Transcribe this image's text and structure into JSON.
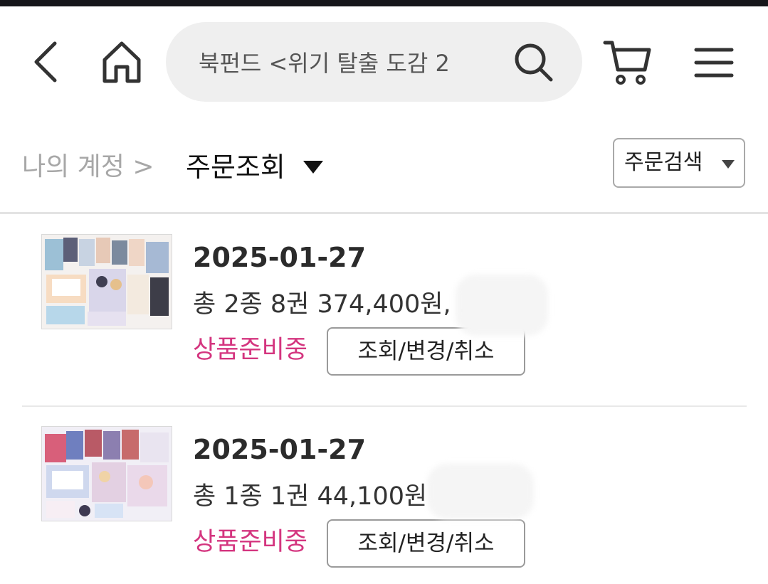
{
  "header": {
    "back_icon": "chevron-left-icon",
    "home_icon": "home-icon",
    "search_text": "북펀드 <위기 탈출 도감 2",
    "search_icon": "search-icon",
    "cart_icon": "cart-icon",
    "menu_icon": "menu-icon"
  },
  "breadcrumb": {
    "parent": "나의 계정 >",
    "current": "주문조회",
    "order_search_label": "주문검색"
  },
  "colors": {
    "status": "#d4357f",
    "search_bg": "#efefef",
    "top_strip": "#16161a"
  },
  "orders": [
    {
      "date": "2025-01-27",
      "summary": "총 2종 8권 374,400원, .",
      "status": "상품준비중",
      "action": "조회/변경/취소"
    },
    {
      "date": "2025-01-27",
      "summary": "총 1종 1권 44,100원",
      "status": "상품준비중",
      "action": "조회/변경/취소"
    }
  ]
}
